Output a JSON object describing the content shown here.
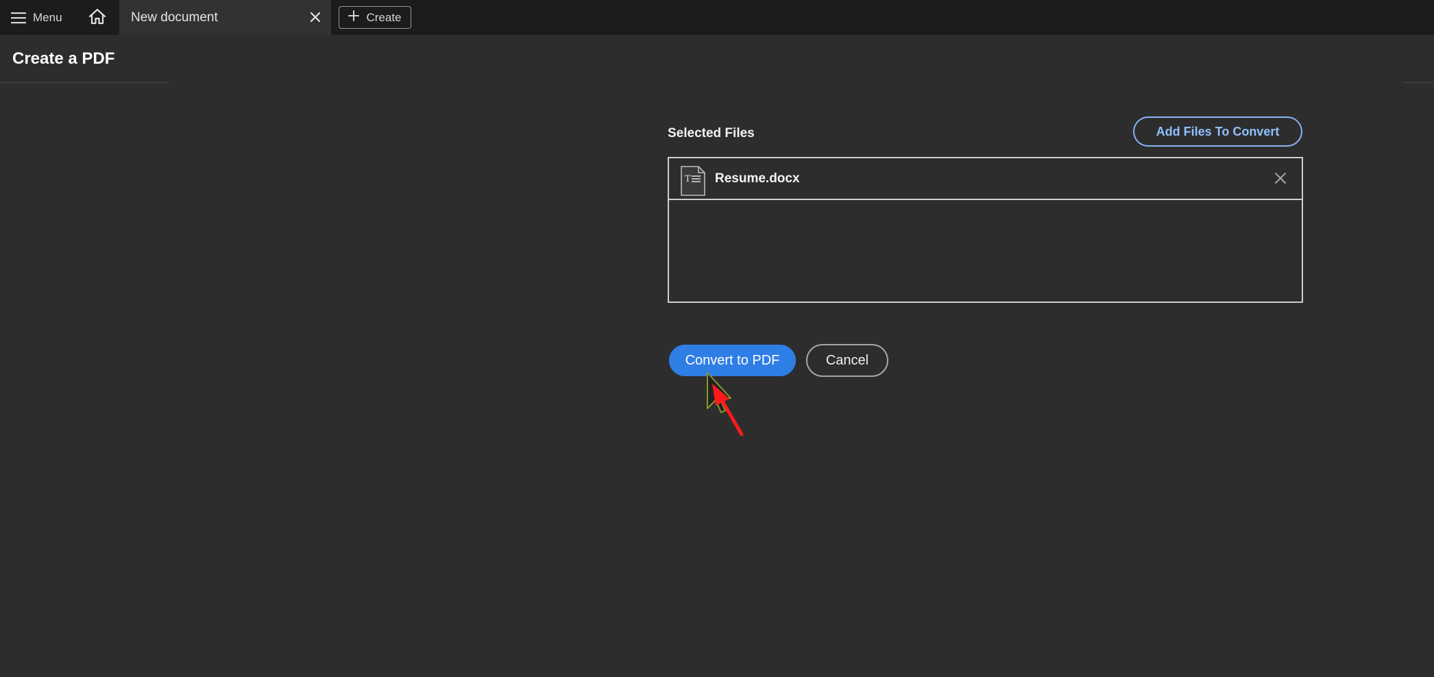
{
  "topbar": {
    "menu_label": "Menu",
    "menu_icon": "hamburger-icon",
    "home_icon": "home-icon",
    "tab": {
      "label": "New document",
      "close_icon": "close-icon"
    },
    "create_label": "Create",
    "create_icon": "plus-icon"
  },
  "page": {
    "title": "Create a PDF"
  },
  "files": {
    "section_label": "Selected Files",
    "add_button_label": "Add Files To Convert",
    "items": [
      {
        "name": "Resume.docx",
        "icon": "document-icon",
        "remove_icon": "close-icon"
      }
    ]
  },
  "actions": {
    "convert_label": "Convert to PDF",
    "cancel_label": "Cancel"
  },
  "colors": {
    "background": "#2d2d2d",
    "topbar": "#1c1c1c",
    "primary": "#2f7ee6",
    "link": "#8fc1ff",
    "annotation_arrow": "#ff1a1a"
  }
}
